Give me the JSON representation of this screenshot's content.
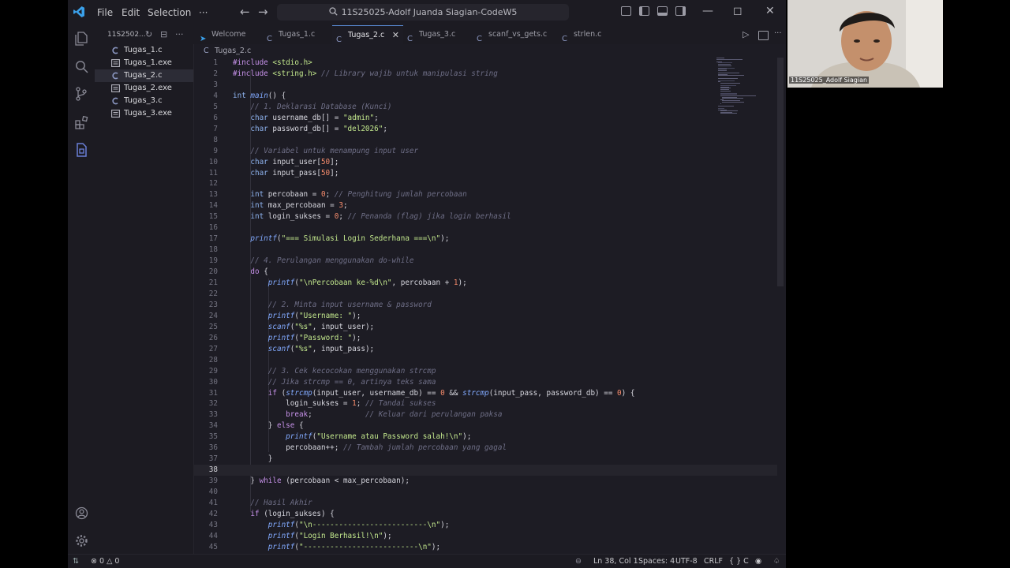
{
  "window": {
    "title": "11S25025-Adolf Juanda Siagian-CodeW5"
  },
  "menu": [
    "File",
    "Edit",
    "Selection",
    "···"
  ],
  "explorer": {
    "header": "11S2502...",
    "files": [
      {
        "name": "Tugas_1.c",
        "icon": "c-file-icon"
      },
      {
        "name": "Tugas_1.exe",
        "icon": "exe-file-icon"
      },
      {
        "name": "Tugas_2.c",
        "icon": "c-file-icon",
        "active": true
      },
      {
        "name": "Tugas_2.exe",
        "icon": "exe-file-icon"
      },
      {
        "name": "Tugas_3.c",
        "icon": "c-file-icon"
      },
      {
        "name": "Tugas_3.exe",
        "icon": "exe-file-icon"
      }
    ]
  },
  "tabs": [
    {
      "label": "Welcome"
    },
    {
      "label": "Tugas_1.c"
    },
    {
      "label": "Tugas_2.c",
      "active": true
    },
    {
      "label": "Tugas_3.c"
    },
    {
      "label": "scanf_vs_gets.c"
    },
    {
      "label": "strlen.c"
    }
  ],
  "breadcrumb": "Tugas_2.c",
  "editor": {
    "current_line": 38,
    "lines": [
      "#include <stdio.h>",
      "#include <string.h> // Library wajib untuk manipulasi string",
      "",
      "int main() {",
      "    // 1. Deklarasi Database (Kunci)",
      "    char username_db[] = \"admin\";",
      "    char password_db[] = \"del2026\";",
      "",
      "    // Variabel untuk menampung input user",
      "    char input_user[50];",
      "    char input_pass[50];",
      "",
      "    int percobaan = 0; // Penghitung jumlah percobaan",
      "    int max_percobaan = 3;",
      "    int login_sukses = 0; // Penanda (flag) jika login berhasil",
      "",
      "    printf(\"=== Simulasi Login Sederhana ===\\n\");",
      "",
      "    // 4. Perulangan menggunakan do-while",
      "    do {",
      "        printf(\"\\nPercobaan ke-%d\\n\", percobaan + 1);",
      "",
      "        // 2. Minta input username & password",
      "        printf(\"Username: \");",
      "        scanf(\"%s\", input_user);",
      "        printf(\"Password: \");",
      "        scanf(\"%s\", input_pass);",
      "",
      "        // 3. Cek kecocokan menggunakan strcmp",
      "        // Jika strcmp == 0, artinya teks sama",
      "        if (strcmp(input_user, username_db) == 0 && strcmp(input_pass, password_db) == 0) {",
      "            login_sukses = 1; // Tandai sukses",
      "            break;            // Keluar dari perulangan paksa",
      "        } else {",
      "            printf(\"Username atau Password salah!\\n\");",
      "            percobaan++; // Tambah jumlah percobaan yang gagal",
      "        }",
      "",
      "    } while (percobaan < max_percobaan);",
      "",
      "    // Hasil Akhir",
      "    if (login_sukses) {",
      "        printf(\"\\n--------------------------\\n\");",
      "        printf(\"Login Berhasil!\\n\");",
      "        printf(\"--------------------------\\n\");"
    ]
  },
  "status": {
    "errors": "0",
    "warnings": "0",
    "position": "Ln 38, Col 1",
    "spaces": "Spaces: 4",
    "encoding": "UTF-8",
    "eol": "CRLF",
    "language": "C"
  },
  "webcam": {
    "label": "11S25025_Adolf Siagian"
  }
}
